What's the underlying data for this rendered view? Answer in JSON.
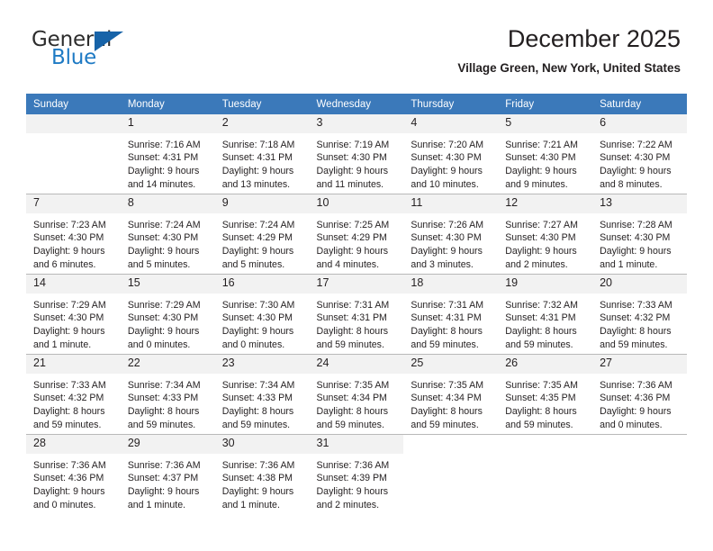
{
  "brand": {
    "name_part1": "General",
    "name_part2": "Blue",
    "accent_color": "#1763a8",
    "text_color": "#2d2d2d"
  },
  "header": {
    "title": "December 2025",
    "location": "Village Green, New York, United States"
  },
  "calendar": {
    "header_bg": "#3b79ba",
    "daynum_bg": "#f2f2f2",
    "weekday_headers": [
      "Sunday",
      "Monday",
      "Tuesday",
      "Wednesday",
      "Thursday",
      "Friday",
      "Saturday"
    ],
    "weeks": [
      [
        {
          "day": "",
          "blank": true,
          "placeholder": true
        },
        {
          "day": "1",
          "sunrise": "Sunrise: 7:16 AM",
          "sunset": "Sunset: 4:31 PM",
          "daylight_line1": "Daylight: 9 hours",
          "daylight_line2": "and 14 minutes."
        },
        {
          "day": "2",
          "sunrise": "Sunrise: 7:18 AM",
          "sunset": "Sunset: 4:31 PM",
          "daylight_line1": "Daylight: 9 hours",
          "daylight_line2": "and 13 minutes."
        },
        {
          "day": "3",
          "sunrise": "Sunrise: 7:19 AM",
          "sunset": "Sunset: 4:30 PM",
          "daylight_line1": "Daylight: 9 hours",
          "daylight_line2": "and 11 minutes."
        },
        {
          "day": "4",
          "sunrise": "Sunrise: 7:20 AM",
          "sunset": "Sunset: 4:30 PM",
          "daylight_line1": "Daylight: 9 hours",
          "daylight_line2": "and 10 minutes."
        },
        {
          "day": "5",
          "sunrise": "Sunrise: 7:21 AM",
          "sunset": "Sunset: 4:30 PM",
          "daylight_line1": "Daylight: 9 hours",
          "daylight_line2": "and 9 minutes."
        },
        {
          "day": "6",
          "sunrise": "Sunrise: 7:22 AM",
          "sunset": "Sunset: 4:30 PM",
          "daylight_line1": "Daylight: 9 hours",
          "daylight_line2": "and 8 minutes."
        }
      ],
      [
        {
          "day": "7",
          "sunrise": "Sunrise: 7:23 AM",
          "sunset": "Sunset: 4:30 PM",
          "daylight_line1": "Daylight: 9 hours",
          "daylight_line2": "and 6 minutes."
        },
        {
          "day": "8",
          "sunrise": "Sunrise: 7:24 AM",
          "sunset": "Sunset: 4:30 PM",
          "daylight_line1": "Daylight: 9 hours",
          "daylight_line2": "and 5 minutes."
        },
        {
          "day": "9",
          "sunrise": "Sunrise: 7:24 AM",
          "sunset": "Sunset: 4:29 PM",
          "daylight_line1": "Daylight: 9 hours",
          "daylight_line2": "and 5 minutes."
        },
        {
          "day": "10",
          "sunrise": "Sunrise: 7:25 AM",
          "sunset": "Sunset: 4:29 PM",
          "daylight_line1": "Daylight: 9 hours",
          "daylight_line2": "and 4 minutes."
        },
        {
          "day": "11",
          "sunrise": "Sunrise: 7:26 AM",
          "sunset": "Sunset: 4:30 PM",
          "daylight_line1": "Daylight: 9 hours",
          "daylight_line2": "and 3 minutes."
        },
        {
          "day": "12",
          "sunrise": "Sunrise: 7:27 AM",
          "sunset": "Sunset: 4:30 PM",
          "daylight_line1": "Daylight: 9 hours",
          "daylight_line2": "and 2 minutes."
        },
        {
          "day": "13",
          "sunrise": "Sunrise: 7:28 AM",
          "sunset": "Sunset: 4:30 PM",
          "daylight_line1": "Daylight: 9 hours",
          "daylight_line2": "and 1 minute."
        }
      ],
      [
        {
          "day": "14",
          "sunrise": "Sunrise: 7:29 AM",
          "sunset": "Sunset: 4:30 PM",
          "daylight_line1": "Daylight: 9 hours",
          "daylight_line2": "and 1 minute."
        },
        {
          "day": "15",
          "sunrise": "Sunrise: 7:29 AM",
          "sunset": "Sunset: 4:30 PM",
          "daylight_line1": "Daylight: 9 hours",
          "daylight_line2": "and 0 minutes."
        },
        {
          "day": "16",
          "sunrise": "Sunrise: 7:30 AM",
          "sunset": "Sunset: 4:30 PM",
          "daylight_line1": "Daylight: 9 hours",
          "daylight_line2": "and 0 minutes."
        },
        {
          "day": "17",
          "sunrise": "Sunrise: 7:31 AM",
          "sunset": "Sunset: 4:31 PM",
          "daylight_line1": "Daylight: 8 hours",
          "daylight_line2": "and 59 minutes."
        },
        {
          "day": "18",
          "sunrise": "Sunrise: 7:31 AM",
          "sunset": "Sunset: 4:31 PM",
          "daylight_line1": "Daylight: 8 hours",
          "daylight_line2": "and 59 minutes."
        },
        {
          "day": "19",
          "sunrise": "Sunrise: 7:32 AM",
          "sunset": "Sunset: 4:31 PM",
          "daylight_line1": "Daylight: 8 hours",
          "daylight_line2": "and 59 minutes."
        },
        {
          "day": "20",
          "sunrise": "Sunrise: 7:33 AM",
          "sunset": "Sunset: 4:32 PM",
          "daylight_line1": "Daylight: 8 hours",
          "daylight_line2": "and 59 minutes."
        }
      ],
      [
        {
          "day": "21",
          "sunrise": "Sunrise: 7:33 AM",
          "sunset": "Sunset: 4:32 PM",
          "daylight_line1": "Daylight: 8 hours",
          "daylight_line2": "and 59 minutes."
        },
        {
          "day": "22",
          "sunrise": "Sunrise: 7:34 AM",
          "sunset": "Sunset: 4:33 PM",
          "daylight_line1": "Daylight: 8 hours",
          "daylight_line2": "and 59 minutes."
        },
        {
          "day": "23",
          "sunrise": "Sunrise: 7:34 AM",
          "sunset": "Sunset: 4:33 PM",
          "daylight_line1": "Daylight: 8 hours",
          "daylight_line2": "and 59 minutes."
        },
        {
          "day": "24",
          "sunrise": "Sunrise: 7:35 AM",
          "sunset": "Sunset: 4:34 PM",
          "daylight_line1": "Daylight: 8 hours",
          "daylight_line2": "and 59 minutes."
        },
        {
          "day": "25",
          "sunrise": "Sunrise: 7:35 AM",
          "sunset": "Sunset: 4:34 PM",
          "daylight_line1": "Daylight: 8 hours",
          "daylight_line2": "and 59 minutes."
        },
        {
          "day": "26",
          "sunrise": "Sunrise: 7:35 AM",
          "sunset": "Sunset: 4:35 PM",
          "daylight_line1": "Daylight: 8 hours",
          "daylight_line2": "and 59 minutes."
        },
        {
          "day": "27",
          "sunrise": "Sunrise: 7:36 AM",
          "sunset": "Sunset: 4:36 PM",
          "daylight_line1": "Daylight: 9 hours",
          "daylight_line2": "and 0 minutes."
        }
      ],
      [
        {
          "day": "28",
          "sunrise": "Sunrise: 7:36 AM",
          "sunset": "Sunset: 4:36 PM",
          "daylight_line1": "Daylight: 9 hours",
          "daylight_line2": "and 0 minutes."
        },
        {
          "day": "29",
          "sunrise": "Sunrise: 7:36 AM",
          "sunset": "Sunset: 4:37 PM",
          "daylight_line1": "Daylight: 9 hours",
          "daylight_line2": "and 1 minute."
        },
        {
          "day": "30",
          "sunrise": "Sunrise: 7:36 AM",
          "sunset": "Sunset: 4:38 PM",
          "daylight_line1": "Daylight: 9 hours",
          "daylight_line2": "and 1 minute."
        },
        {
          "day": "31",
          "sunrise": "Sunrise: 7:36 AM",
          "sunset": "Sunset: 4:39 PM",
          "daylight_line1": "Daylight: 9 hours",
          "daylight_line2": "and 2 minutes."
        },
        {
          "day": "",
          "blank": true
        },
        {
          "day": "",
          "blank": true
        },
        {
          "day": "",
          "blank": true
        }
      ]
    ]
  }
}
